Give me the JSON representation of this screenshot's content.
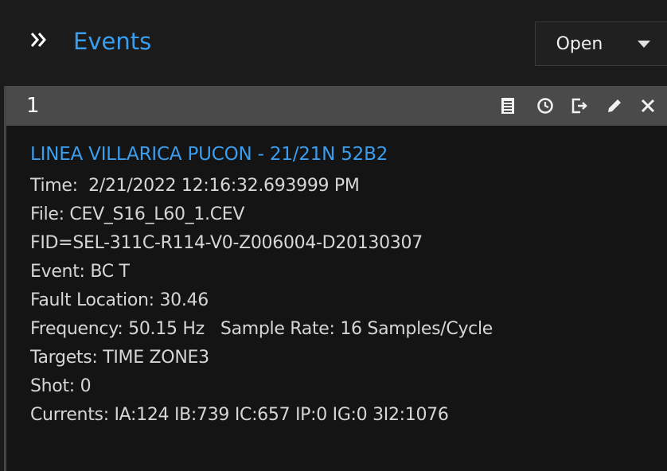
{
  "header": {
    "title": "Events",
    "open_label": "Open"
  },
  "event": {
    "number": "1",
    "name": "LINEA VILLARICA PUCON - 21/21N 52B2",
    "lines": [
      "Time:  2/21/2022 12:16:32.693999 PM",
      "File: CEV_S16_L60_1.CEV",
      "FID=SEL-311C-R114-V0-Z006004-D20130307",
      "Event: BC T",
      "Fault Location: 30.46",
      "Frequency: 50.15 Hz   Sample Rate: 16 Samples/Cycle",
      "Targets: TIME ZONE3",
      "Shot: 0",
      "Currents: IA:124 IB:739 IC:657 IP:0 IG:0 3I2:1076"
    ]
  },
  "colors": {
    "accent": "#3a9ef0",
    "background": "#1b1b1b",
    "card_header": "#4a4a4a",
    "text": "#d6d6d6"
  },
  "icons": {
    "expand": "double-chevron-right-icon",
    "dropdown": "caret-down-icon",
    "tools": [
      "report-icon",
      "clock-icon",
      "export-icon",
      "edit-icon",
      "close-icon"
    ]
  }
}
